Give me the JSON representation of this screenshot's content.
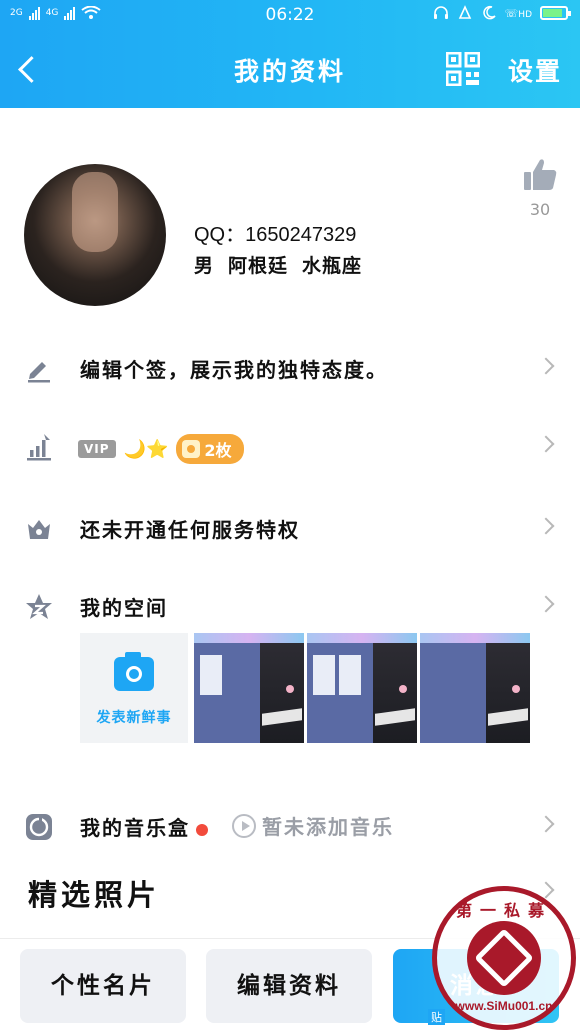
{
  "status_bar": {
    "sim1": "2G",
    "sim2": "4G",
    "time": "06:22",
    "hd": "HD",
    "battery_level": 0.85
  },
  "nav": {
    "title": "我的资料",
    "settings_label": "设置"
  },
  "profile": {
    "qq_label": "QQ：",
    "qq_number": "1650247329",
    "gender": "男",
    "location": "阿根廷",
    "zodiac": "水瓶座",
    "likes": "30"
  },
  "rows": {
    "signature": "编辑个签，展示我的独特态度。",
    "vip_badge": "VIP",
    "level_icons": "🌙⭐",
    "coin_count": "2枚",
    "privilege": "还未开通任何服务特权",
    "space": "我的空间",
    "post_new": "发表新鲜事",
    "music_box": "我的音乐盒",
    "music_empty": "暂未添加音乐"
  },
  "featured_photos_title": "精选照片",
  "bottom": {
    "card_button": "个性名片",
    "edit_button": "编辑资料",
    "third_button": "消息",
    "third_tag": "贴"
  },
  "watermark": {
    "top_text": "第一私募",
    "bottom_text": "www.SiMu001.cn"
  },
  "colors": {
    "brand": "#1ea6f4",
    "accent_orange": "#f6a93b",
    "music_dot": "#f24b3c",
    "watermark": "#a9192a"
  }
}
